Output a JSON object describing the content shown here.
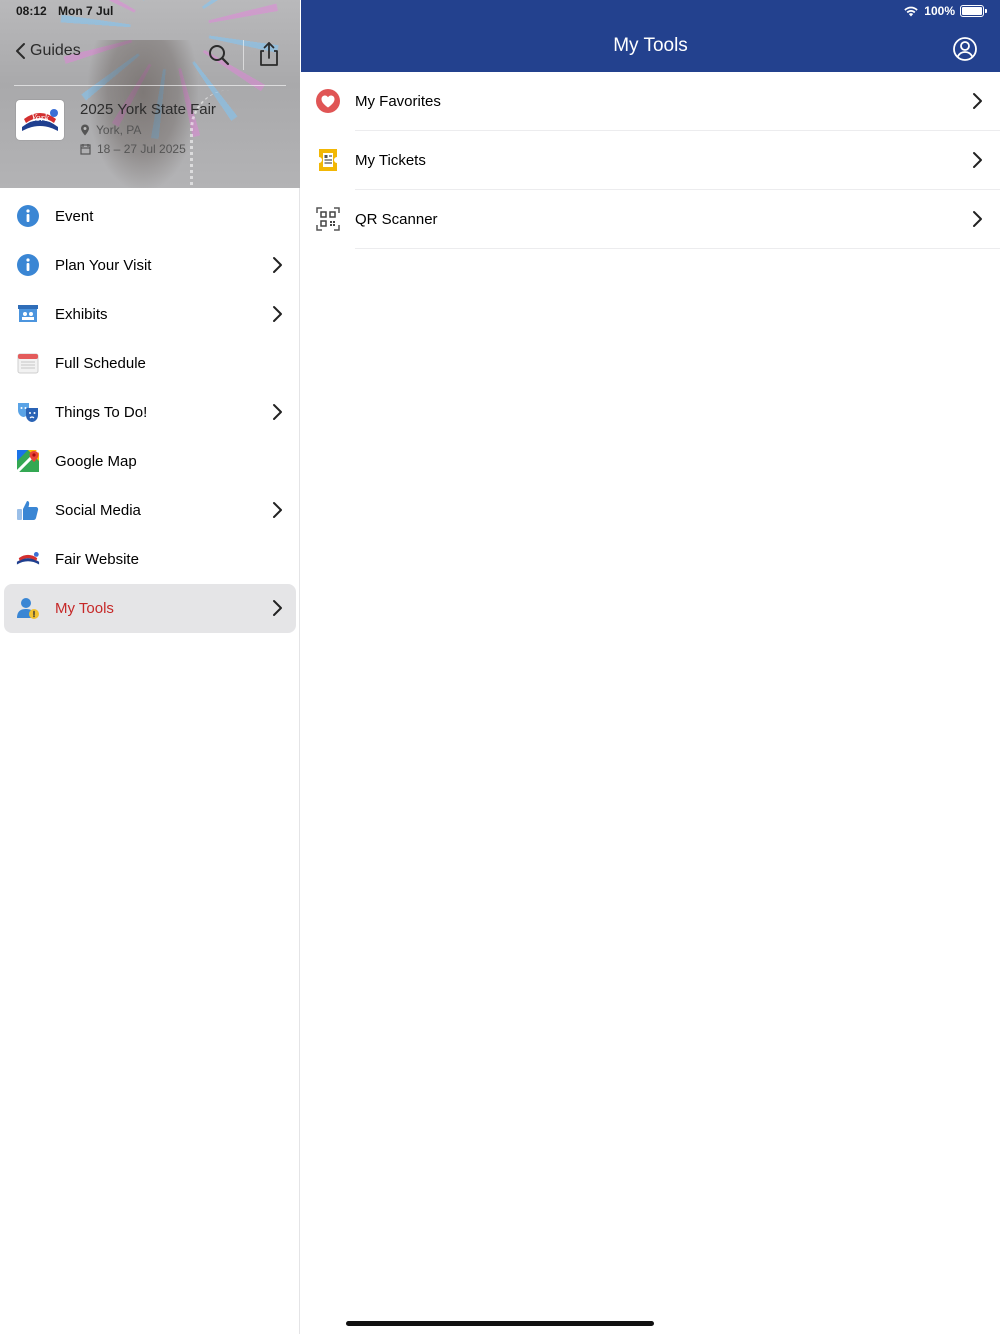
{
  "status_bar": {
    "time": "08:12",
    "date": "Mon 7 Jul",
    "battery": "100%"
  },
  "sidebar": {
    "back_label": "Guides",
    "event": {
      "title": "2025 York State Fair",
      "location": "York, PA",
      "dates": "18 – 27 Jul 2025"
    },
    "items": [
      {
        "label": "Event",
        "icon": "info-icon",
        "chevron": false
      },
      {
        "label": "Plan Your Visit",
        "icon": "info-icon",
        "chevron": true
      },
      {
        "label": "Exhibits",
        "icon": "exhibits-icon",
        "chevron": true
      },
      {
        "label": "Full Schedule",
        "icon": "calendar-icon",
        "chevron": false
      },
      {
        "label": "Things To Do!",
        "icon": "theater-masks-icon",
        "chevron": true
      },
      {
        "label": "Google Map",
        "icon": "google-maps-icon",
        "chevron": false
      },
      {
        "label": "Social Media",
        "icon": "thumbs-up-icon",
        "chevron": true
      },
      {
        "label": "Fair Website",
        "icon": "york-logo-icon",
        "chevron": false
      },
      {
        "label": "My Tools",
        "icon": "user-tools-icon",
        "chevron": true,
        "active": true
      }
    ]
  },
  "main": {
    "title": "My Tools",
    "rows": [
      {
        "label": "My Favorites",
        "icon": "heart-icon"
      },
      {
        "label": "My Tickets",
        "icon": "ticket-icon"
      },
      {
        "label": "QR Scanner",
        "icon": "qr-code-icon"
      }
    ]
  },
  "colors": {
    "nav_bar": "#23418e",
    "active_text": "#c62828",
    "info_blue": "#3a86d4",
    "heart_red": "#e05555",
    "ticket_yellow": "#f2b705"
  }
}
